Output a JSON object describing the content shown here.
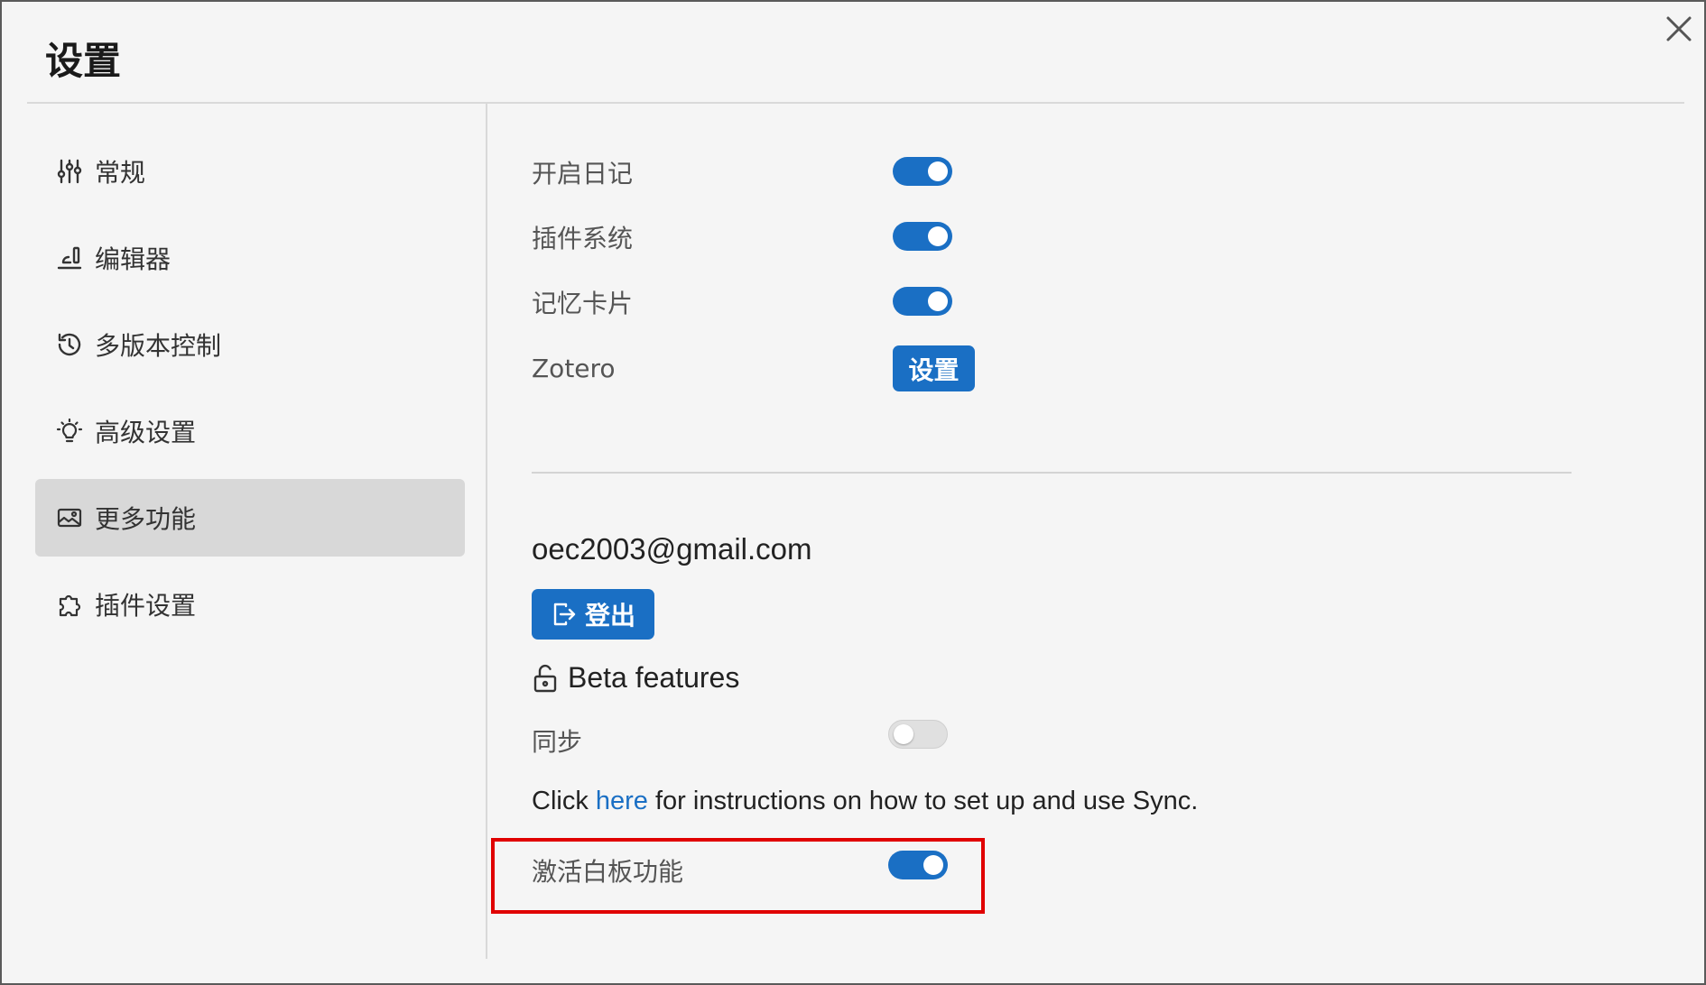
{
  "dialog": {
    "title": "设置",
    "close_icon": "close-icon"
  },
  "sidebar": {
    "items": [
      {
        "label": "常规",
        "icon": "sliders-icon",
        "active": false
      },
      {
        "label": "编辑器",
        "icon": "editor-icon",
        "active": false
      },
      {
        "label": "多版本控制",
        "icon": "history-icon",
        "active": false
      },
      {
        "label": "高级设置",
        "icon": "lightbulb-icon",
        "active": false
      },
      {
        "label": "更多功能",
        "icon": "image-icon",
        "active": true
      },
      {
        "label": "插件设置",
        "icon": "puzzle-icon",
        "active": false
      }
    ]
  },
  "features": {
    "journals": {
      "label": "开启日记",
      "enabled": true
    },
    "plugins": {
      "label": "插件系统",
      "enabled": true
    },
    "flashcards": {
      "label": "记忆卡片",
      "enabled": true
    },
    "zotero": {
      "label": "Zotero",
      "button_label": "设置"
    }
  },
  "account": {
    "email": "oec2003@gmail.com",
    "logout_label": "登出"
  },
  "beta": {
    "title": "Beta features",
    "sync": {
      "label": "同步",
      "enabled": false
    },
    "sync_note_prefix": "Click ",
    "sync_note_link": "here",
    "sync_note_suffix": " for instructions on how to set up and use Sync.",
    "whiteboard": {
      "label": "激活白板功能",
      "enabled": true
    }
  },
  "colors": {
    "accent": "#1a6fc4",
    "highlight": "#e00000"
  }
}
